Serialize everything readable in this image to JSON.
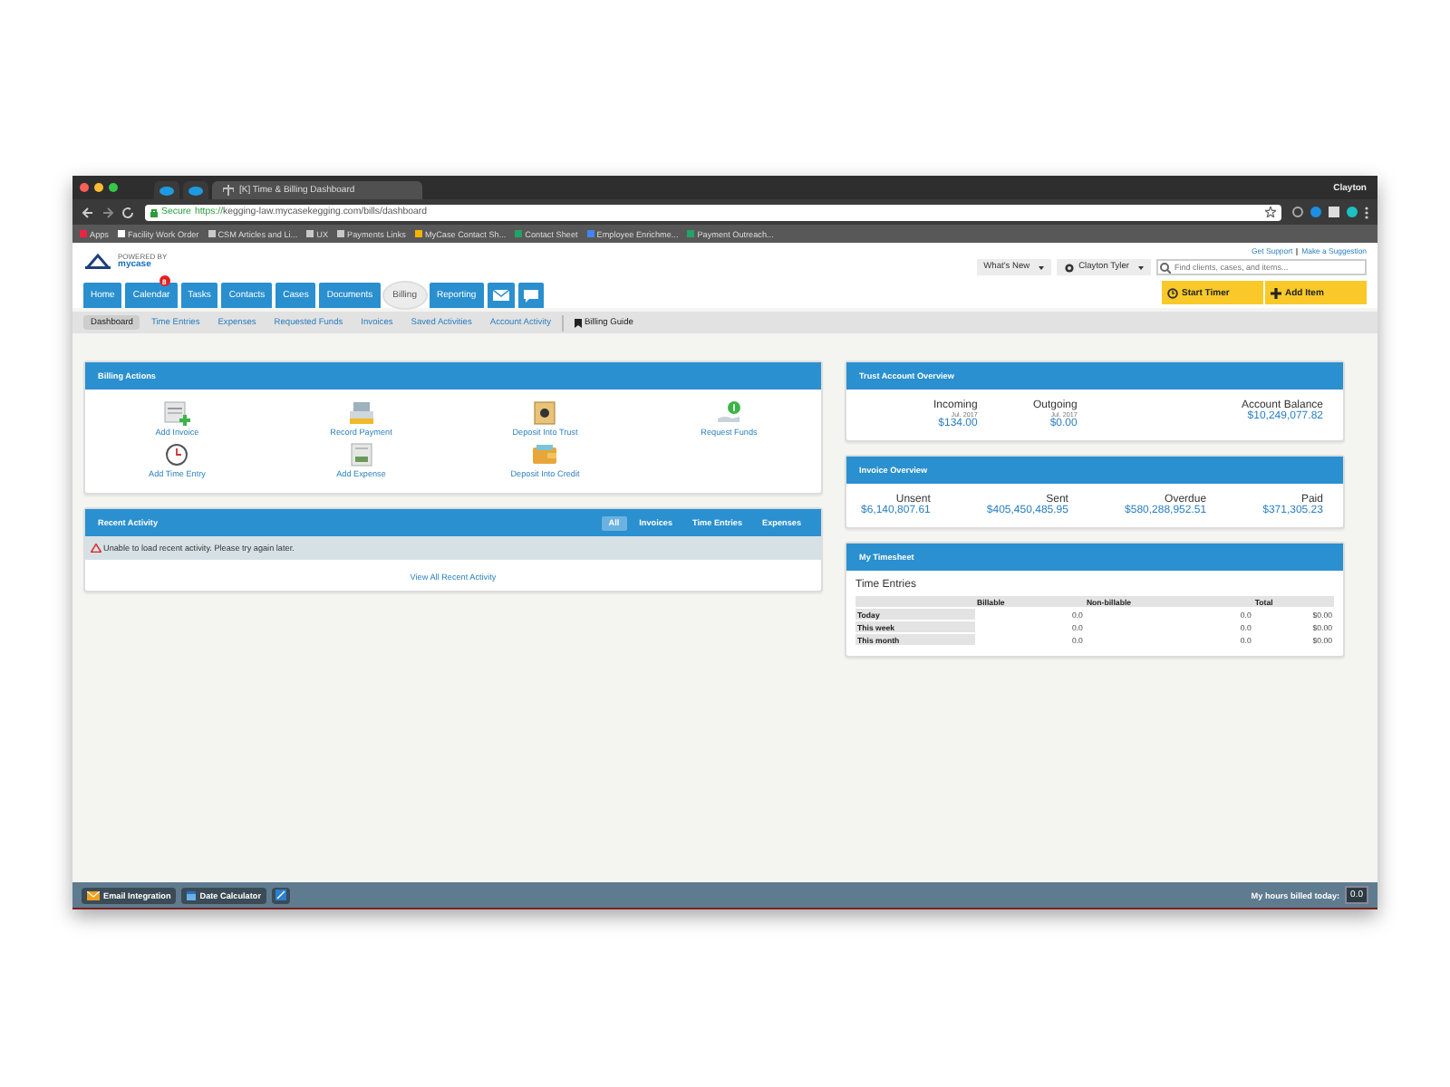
{
  "browser": {
    "tabs": [
      {
        "kind": "icon",
        "selected": false
      },
      {
        "kind": "icon",
        "selected": false
      },
      {
        "kind": "page",
        "title": "[K] Time & Billing Dashboard",
        "selected": true
      }
    ],
    "profile": "Clayton",
    "address": {
      "secure_label": "Secure",
      "scheme": "https://",
      "url": "kegging-law.mycasekegging.com/bills/dashboard"
    },
    "bookmarks": [
      {
        "kind": "apps",
        "label": "Apps"
      },
      {
        "kind": "page",
        "label": "Facility Work Order"
      },
      {
        "kind": "folder",
        "label": "CSM Articles and Li..."
      },
      {
        "kind": "folder",
        "label": "UX"
      },
      {
        "kind": "folder",
        "label": "Payments Links"
      },
      {
        "kind": "drive",
        "label": "MyCase Contact Sh..."
      },
      {
        "kind": "sheet",
        "label": "Contact Sheet"
      },
      {
        "kind": "doc",
        "label": "Employee Enrichme..."
      },
      {
        "kind": "sheet",
        "label": "Payment Outreach..."
      }
    ]
  },
  "header": {
    "powered_by": "POWERED BY",
    "brand": "mycase",
    "links": [
      "Get Support",
      "Make a Suggestion"
    ],
    "whats_new": "What's New",
    "user": "Clayton Tyler",
    "search": {
      "placeholder": "Find clients, cases, and items..."
    },
    "start_timer": "Start Timer",
    "add_item": "Add Item"
  },
  "nav": [
    {
      "kind": "text",
      "label": "Home",
      "selected": false
    },
    {
      "kind": "text",
      "label": "Calendar",
      "badge": "8",
      "selected": false
    },
    {
      "kind": "text",
      "label": "Tasks",
      "selected": false
    },
    {
      "kind": "text",
      "label": "Contacts",
      "selected": false
    },
    {
      "kind": "text",
      "label": "Cases",
      "selected": false
    },
    {
      "kind": "text",
      "label": "Documents",
      "selected": false
    },
    {
      "kind": "text",
      "label": "Billing",
      "selected": true
    },
    {
      "kind": "text",
      "label": "Reporting",
      "selected": false
    },
    {
      "kind": "mail",
      "selected": false
    },
    {
      "kind": "chat",
      "selected": false
    }
  ],
  "subnav": [
    {
      "label": "Dashboard",
      "selected": true
    },
    {
      "label": "Time Entries",
      "selected": false
    },
    {
      "label": "Expenses",
      "selected": false
    },
    {
      "label": "Requested Funds",
      "selected": false
    },
    {
      "label": "Invoices",
      "selected": false
    },
    {
      "label": "Saved Activities",
      "selected": false
    },
    {
      "label": "Account Activity",
      "selected": false
    }
  ],
  "billing_guide": "Billing Guide",
  "billing_actions": {
    "title": "Billing Actions",
    "actions": [
      {
        "kind": "invoice",
        "label": "Add Invoice"
      },
      {
        "kind": "payment",
        "label": "Record Payment"
      },
      {
        "kind": "safe",
        "label": "Deposit Into Trust"
      },
      {
        "kind": "request",
        "label": "Request Funds"
      },
      {
        "kind": "clock",
        "label": "Add Time Entry"
      },
      {
        "kind": "expense",
        "label": "Add Expense"
      },
      {
        "kind": "wallet",
        "label": "Deposit Into Credit"
      }
    ]
  },
  "recent_activity": {
    "title": "Recent Activity",
    "tabs": [
      {
        "label": "All",
        "selected": true
      },
      {
        "label": "Invoices",
        "selected": false
      },
      {
        "label": "Time Entries",
        "selected": false
      },
      {
        "label": "Expenses",
        "selected": false
      }
    ],
    "error": "Unable to load recent activity. Please try again later.",
    "link": "View All Recent Activity"
  },
  "trust_overview": {
    "title": "Trust Account Overview",
    "items": [
      {
        "label": "Incoming",
        "period": "Jul. 2017",
        "amount": "$134.00"
      },
      {
        "label": "Outgoing",
        "period": "Jul. 2017",
        "amount": "$0.00"
      },
      {
        "label": "Account Balance",
        "amount": "$10,249,077.82"
      }
    ]
  },
  "invoice_overview": {
    "title": "Invoice Overview",
    "items": [
      {
        "label": "Unsent",
        "amount": "$6,140,807.61"
      },
      {
        "label": "Sent",
        "amount": "$405,450,485.95"
      },
      {
        "label": "Overdue",
        "amount": "$580,288,952.51"
      },
      {
        "label": "Paid",
        "amount": "$371,305.23"
      }
    ]
  },
  "timesheet": {
    "title": "My Timesheet",
    "subtitle": "Time Entries",
    "columns": [
      "Billable",
      "Non-billable",
      "Total"
    ],
    "rows": [
      {
        "label": "Today",
        "cells": [
          "0.0",
          "0.0",
          "$0.00"
        ]
      },
      {
        "label": "This week",
        "cells": [
          "0.0",
          "0.0",
          "$0.00"
        ]
      },
      {
        "label": "This month",
        "cells": [
          "0.0",
          "0.0",
          "$0.00"
        ]
      }
    ]
  },
  "footer": {
    "buttons": [
      {
        "kind": "email",
        "label": "Email Integration"
      },
      {
        "kind": "calendar",
        "label": "Date Calculator"
      },
      {
        "kind": "icon"
      }
    ],
    "hours_label": "My hours billed today:",
    "hours": "0.0"
  }
}
